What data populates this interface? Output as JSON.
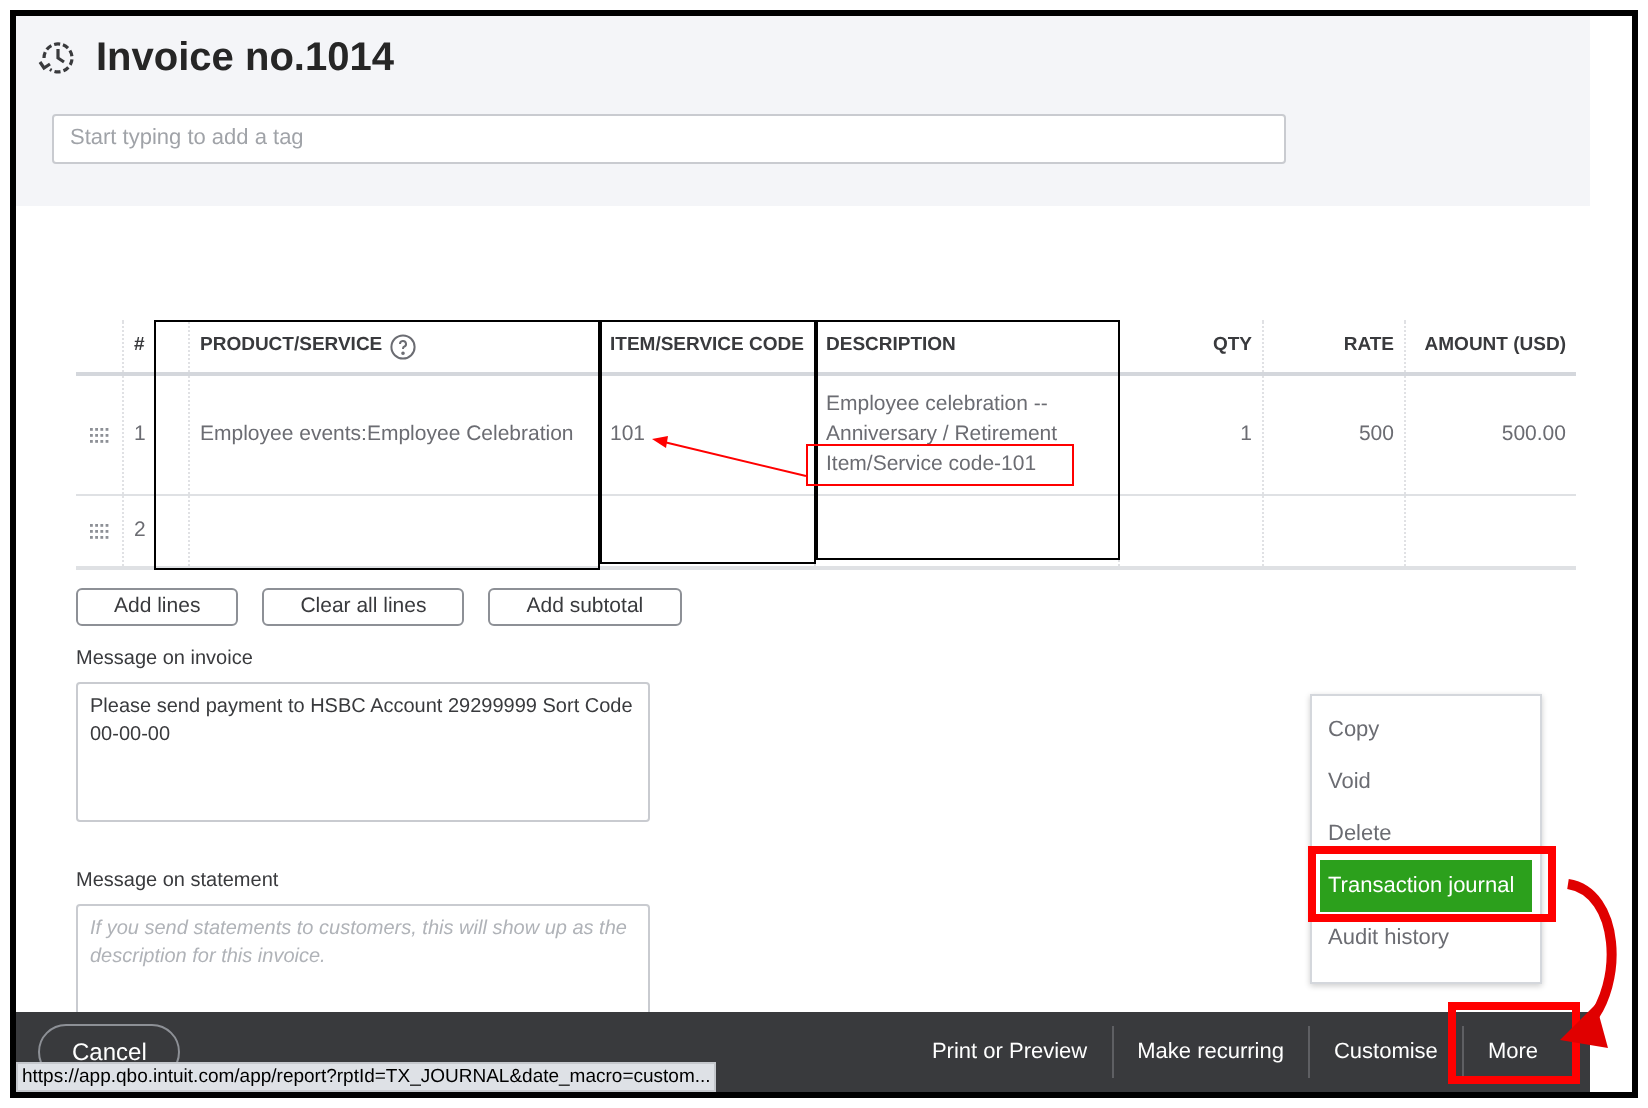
{
  "title": "Invoice no.1014",
  "tag_field": {
    "placeholder": "Start typing to add a tag"
  },
  "table": {
    "columns": [
      "#",
      "PRODUCT/SERVICE",
      "ITEM/SERVICE CODE",
      "DESCRIPTION",
      "QTY",
      "RATE",
      "AMOUNT (USD)"
    ],
    "rows": [
      {
        "number": "1",
        "product": "Employee events:Employee Celebration",
        "code": "101",
        "description": "Employee celebration -- Anniversary / Retirement",
        "description_note": "Item/Service code-101",
        "qty": "1",
        "rate": "500",
        "amount": "500.00"
      },
      {
        "number": "2"
      }
    ]
  },
  "table_buttons": [
    "Add lines",
    "Clear all lines",
    "Add subtotal"
  ],
  "message_on_invoice": {
    "label": "Message on invoice",
    "value": "Please send payment to HSBC Account 29299999 Sort Code 00-00-00"
  },
  "message_on_statement": {
    "label": "Message on statement",
    "placeholder": "If you send statements to customers, this will show up as the description for this invoice."
  },
  "more_menu": [
    {
      "label": "Copy",
      "selected": false
    },
    {
      "label": "Void",
      "selected": false
    },
    {
      "label": "Delete",
      "selected": false
    },
    {
      "label": "Transaction journal",
      "selected": true
    },
    {
      "label": "Audit history",
      "selected": false
    }
  ],
  "footer": {
    "cancel": "Cancel",
    "actions": [
      "Print or Preview",
      "Make recurring",
      "Customise",
      "More"
    ]
  },
  "link_preview": "https://app.qbo.intuit.com/app/report?rptId=TX_JOURNAL&date_macro=custom..."
}
